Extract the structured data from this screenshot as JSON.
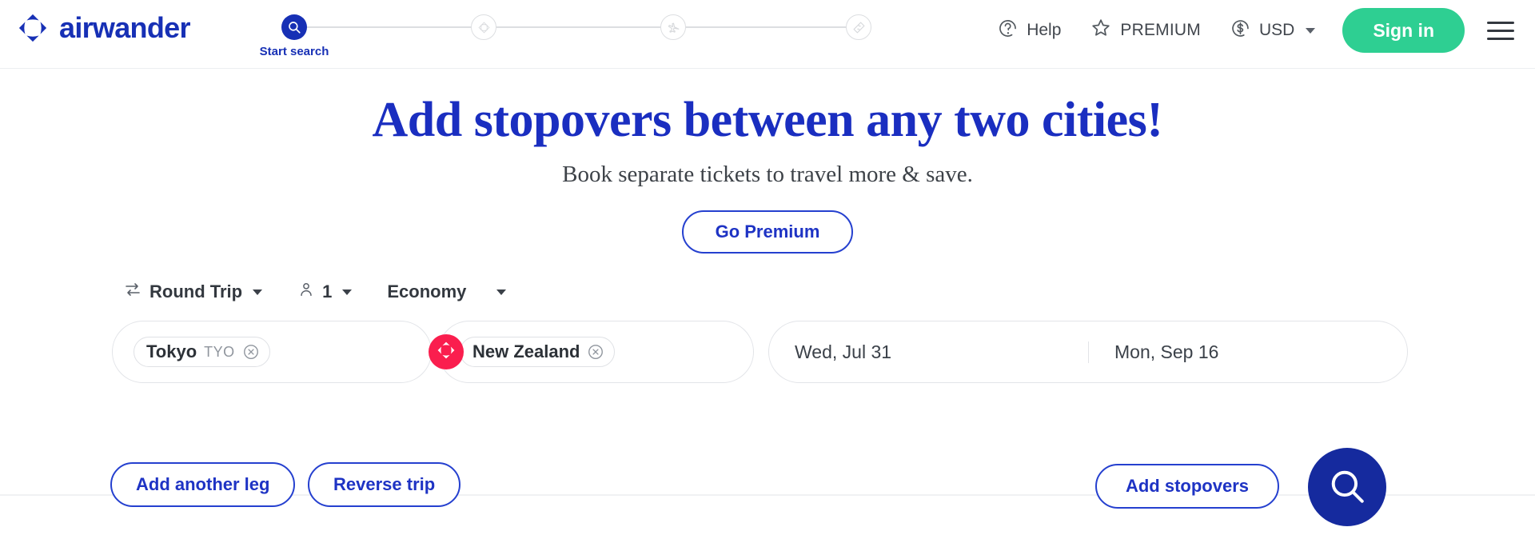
{
  "brand": {
    "name": "airwander",
    "logo_icon": "airwander-diamond-logo",
    "primary_blue": "#1730b5",
    "deep_blue": "#152a9e",
    "accent_green": "#2ecf92",
    "accent_red": "#fa1e4e"
  },
  "stepper": {
    "steps": [
      {
        "icon": "search-icon",
        "label": "Start search",
        "state": "active"
      },
      {
        "icon": "compass-icon",
        "label": "",
        "state": "inactive"
      },
      {
        "icon": "plane-icon",
        "label": "",
        "state": "inactive"
      },
      {
        "icon": "ticket-icon",
        "label": "",
        "state": "inactive"
      }
    ]
  },
  "header": {
    "help_label": "Help",
    "help_icon": "question-circle-icon",
    "premium_label": "PREMIUM",
    "premium_icon": "star-icon",
    "currency_label": "USD",
    "currency_icon": "dollar-circle-icon",
    "currency_caret": "chevron-down-icon",
    "signin_label": "Sign in",
    "menu_icon": "hamburger-menu-icon"
  },
  "hero": {
    "title": "Add stopovers between any two cities!",
    "subtitle": "Book separate tickets to travel more & save.",
    "premium_button": "Go Premium"
  },
  "search": {
    "trip_type": {
      "label": "Round Trip",
      "icon": "swap-arrows-icon",
      "caret": "chevron-down-icon"
    },
    "passengers": {
      "label": "1",
      "icon": "person-icon",
      "caret": "chevron-down-icon"
    },
    "cabin_class": {
      "label": "Economy",
      "caret": "chevron-down-icon"
    },
    "origin": {
      "city": "Tokyo",
      "code": "TYO",
      "remove_icon": "close-circle-icon",
      "placeholder": "From"
    },
    "destination": {
      "city": "New Zealand",
      "code": "",
      "remove_icon": "close-circle-icon",
      "placeholder": "To"
    },
    "swap_icon": "airwander-diamond-logo",
    "depart_date": "Wed, Jul 31",
    "return_date": "Mon, Sep 16"
  },
  "actions": {
    "add_leg": "Add another leg",
    "reverse_trip": "Reverse trip",
    "add_stopovers": "Add stopovers",
    "search_icon": "search-icon"
  }
}
